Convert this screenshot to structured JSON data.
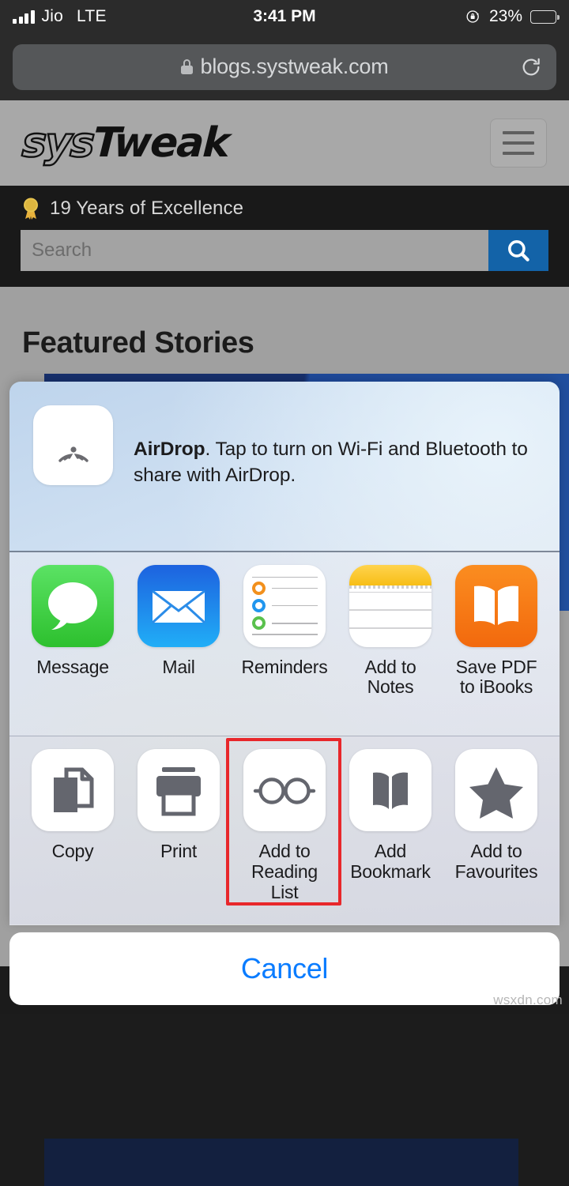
{
  "status_bar": {
    "carrier": "Jio",
    "network": "LTE",
    "time": "3:41 PM",
    "battery_percent": "23%",
    "battery_level": 23,
    "signal_bars": 4,
    "rotation_lock": true
  },
  "browser": {
    "url": "blogs.systweak.com",
    "secure": true,
    "reload_label": "Reload"
  },
  "site": {
    "logo_part1": "sys",
    "logo_part2": "Tweak",
    "menu_label": "Menu",
    "tagline": "19 Years of Excellence",
    "search": {
      "placeholder": "Search",
      "value": "",
      "button_label": "Search"
    },
    "featured_heading": "Featured Stories"
  },
  "share_sheet": {
    "airdrop": {
      "title": "AirDrop",
      "description": ". Tap to turn on Wi-Fi and Bluetooth to share with AirDrop.",
      "icon": "airdrop-icon"
    },
    "apps": [
      {
        "label": "Message",
        "icon": "messages-icon"
      },
      {
        "label": "Mail",
        "icon": "mail-icon"
      },
      {
        "label": "Reminders",
        "icon": "reminders-icon"
      },
      {
        "label": "Add to Notes",
        "icon": "notes-icon"
      },
      {
        "label": "Save PDF\nto iBooks",
        "icon": "ibooks-icon"
      }
    ],
    "actions": [
      {
        "label": "Copy",
        "icon": "copy-icon",
        "highlighted": false
      },
      {
        "label": "Print",
        "icon": "printer-icon",
        "highlighted": false
      },
      {
        "label": "Add to\nReading List",
        "icon": "glasses-icon",
        "highlighted": true
      },
      {
        "label": "Add\nBookmark",
        "icon": "open-book-icon",
        "highlighted": false
      },
      {
        "label": "Add to\nFavourites",
        "icon": "star-icon",
        "highlighted": false
      }
    ],
    "cancel_label": "Cancel",
    "highlight_color": "#e8272b"
  },
  "watermark": "wsxdn.com",
  "colors": {
    "accent_blue": "#0a7cff",
    "search_button": "#1363a8",
    "status_bar_bg": "#2b2b2b",
    "page_bg": "#a0a0a0"
  }
}
